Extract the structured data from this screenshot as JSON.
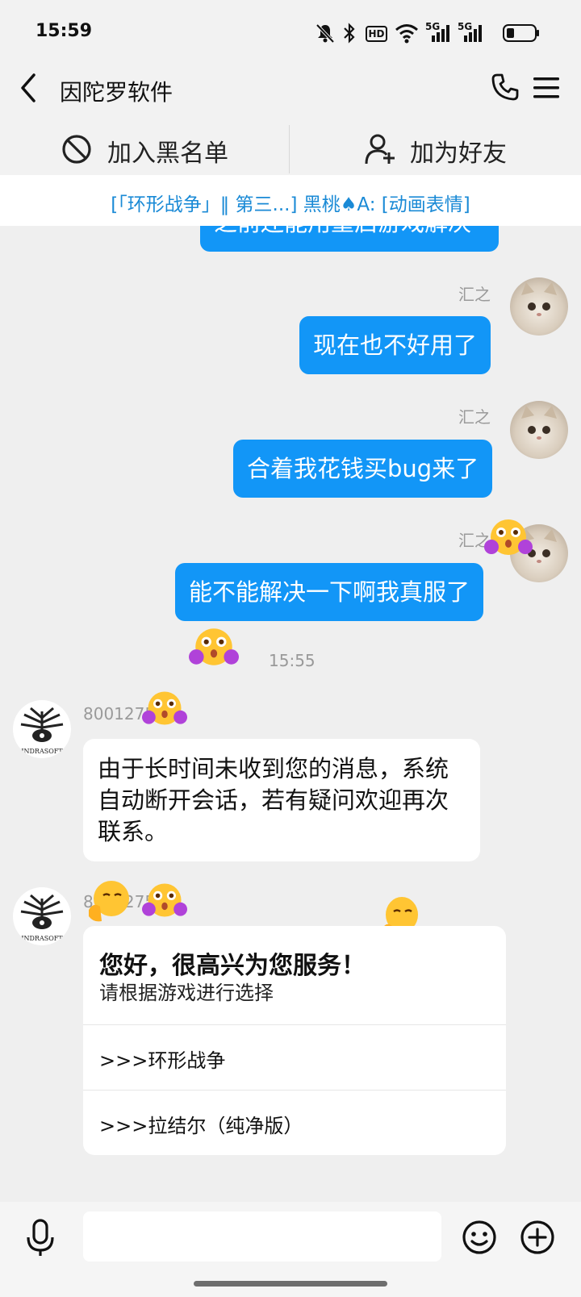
{
  "status_bar": {
    "time": "15:59",
    "icons": [
      "mute-icon",
      "bluetooth-icon",
      "hd-icon",
      "wifi-icon",
      "5g-signal-icon",
      "5g-signal-icon",
      "battery-icon"
    ],
    "hd_label": "HD",
    "net1": "5G",
    "net2": "5G"
  },
  "nav": {
    "title": "因陀罗软件",
    "back_icon": "chevron-left-icon",
    "call_icon": "phone-icon",
    "menu_icon": "menu-icon"
  },
  "actions": {
    "block_label": "加入黑名单",
    "add_friend_label": "加为好友"
  },
  "pinned": {
    "text": "[「环形战争」‖ 第三...] 黑桃♠A: [动画表情]"
  },
  "messages": {
    "partial_text": "之前还能用重启游戏解决",
    "m1": {
      "sender": "汇之",
      "text": "现在也不好用了"
    },
    "m2": {
      "sender": "汇之",
      "text": "合着我花钱买bug来了"
    },
    "m3": {
      "sender": "汇之",
      "text": "能不能解决一下啊我真服了"
    },
    "timestamp": "15:55",
    "sys1": {
      "sender": "8001275",
      "text": "由于长时间未收到您的消息，系统自动断开会话，若有疑问欢迎再次联系。"
    },
    "sys2": {
      "sender": "8001275",
      "greeting": "您好，很高兴为您服务！",
      "subtitle": "请根据游戏进行选择",
      "options": [
        ">>>环形战争",
        ">>>拉结尔（纯净版）"
      ]
    },
    "avatar_brand_text": "INDRASOFT"
  },
  "input": {
    "value": "",
    "icons": [
      "microphone-icon",
      "emoji-icon",
      "plus-icon"
    ]
  },
  "colors": {
    "accent": "#1296f7",
    "link": "#1a8ad6",
    "background": "#efefef"
  }
}
